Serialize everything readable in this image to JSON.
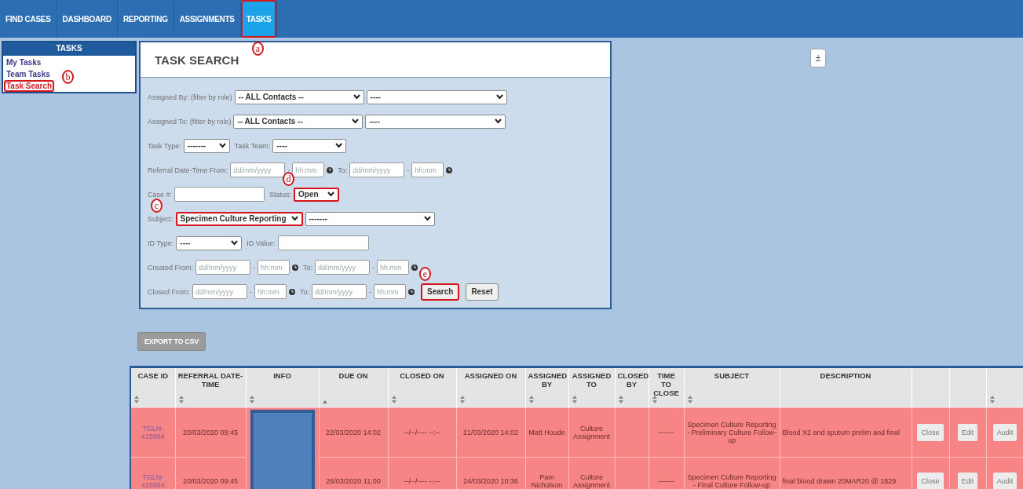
{
  "nav": {
    "tabs": [
      {
        "label": "FIND CASES",
        "selected": false,
        "highlighted": false
      },
      {
        "label": "DASHBOARD",
        "selected": false,
        "highlighted": false
      },
      {
        "label": "REPORTING",
        "selected": false,
        "highlighted": false
      },
      {
        "label": "ASSIGNMENTS",
        "selected": false,
        "highlighted": false
      },
      {
        "label": "TASKS",
        "selected": true,
        "highlighted": true
      }
    ]
  },
  "sidebar": {
    "title": "TASKS",
    "items": [
      {
        "label": "My Tasks",
        "selected": false,
        "highlighted": false
      },
      {
        "label": "Team Tasks",
        "selected": false,
        "highlighted": false
      },
      {
        "label": "Task Search",
        "selected": true,
        "highlighted": true
      }
    ]
  },
  "task_search": {
    "title": "TASK SEARCH",
    "lines": [
      {
        "items": [
          {
            "kind": "label",
            "text": "Assigned By: (filter by role)"
          },
          {
            "kind": "select",
            "value": "-- ALL Contacts --",
            "highlighted": false
          },
          {
            "kind": "select",
            "value": "----",
            "highlighted": false
          }
        ]
      },
      {
        "items": [
          {
            "kind": "label",
            "text": "Assigned To: (filter by role)"
          },
          {
            "kind": "select",
            "value": "-- ALL Contacts --",
            "highlighted": false
          },
          {
            "kind": "select",
            "value": "----",
            "highlighted": false
          }
        ]
      },
      {
        "items": [
          {
            "kind": "label",
            "text": "Task Type:"
          },
          {
            "kind": "select",
            "value": "-------",
            "highlighted": false
          },
          {
            "kind": "label",
            "text": "Task Team:"
          },
          {
            "kind": "select",
            "value": "----",
            "highlighted": false
          }
        ]
      },
      {
        "items": [
          {
            "kind": "label",
            "text": "Referral Date-Time From:"
          },
          {
            "kind": "date",
            "placeholder": "dd/mm/yyyy"
          },
          {
            "kind": "dash",
            "text": "-"
          },
          {
            "kind": "time",
            "placeholder": "hh:mm"
          },
          {
            "kind": "clock"
          },
          {
            "kind": "label",
            "text": "To:"
          },
          {
            "kind": "date",
            "placeholder": "dd/mm/yyyy"
          },
          {
            "kind": "dash",
            "text": "-"
          },
          {
            "kind": "time",
            "placeholder": "hh:mm"
          },
          {
            "kind": "clock"
          }
        ]
      },
      {
        "items": [
          {
            "kind": "label",
            "text": "Case #:"
          },
          {
            "kind": "input"
          },
          {
            "kind": "label",
            "text": "Status:"
          },
          {
            "kind": "select",
            "value": "Open",
            "highlighted": true
          }
        ]
      },
      {
        "items": [
          {
            "kind": "label",
            "text": "Subject:"
          },
          {
            "kind": "select",
            "value": "Specimen Culture Reporting",
            "highlighted": true
          },
          {
            "kind": "select",
            "value": "-------",
            "highlighted": false
          }
        ]
      },
      {
        "items": [
          {
            "kind": "label",
            "text": "ID Type:"
          },
          {
            "kind": "select",
            "value": "----",
            "highlighted": false
          },
          {
            "kind": "label",
            "text": "ID Value:"
          },
          {
            "kind": "input"
          }
        ]
      },
      {
        "items": [
          {
            "kind": "label",
            "text": "Created From:"
          },
          {
            "kind": "date",
            "placeholder": "dd/mm/yyyy"
          },
          {
            "kind": "dash",
            "text": "-"
          },
          {
            "kind": "time",
            "placeholder": "hh:mm"
          },
          {
            "kind": "clock"
          },
          {
            "kind": "label",
            "text": "To:"
          },
          {
            "kind": "date",
            "placeholder": "dd/mm/yyyy"
          },
          {
            "kind": "dash",
            "text": "-"
          },
          {
            "kind": "time",
            "placeholder": "hh:mm"
          },
          {
            "kind": "clock"
          }
        ]
      },
      {
        "items": [
          {
            "kind": "label",
            "text": "Closed From:"
          },
          {
            "kind": "date",
            "placeholder": "dd/mm/yyyy"
          },
          {
            "kind": "dash",
            "text": "-"
          },
          {
            "kind": "time",
            "placeholder": "hh:mm"
          },
          {
            "kind": "clock"
          },
          {
            "kind": "label",
            "text": "To:"
          },
          {
            "kind": "date",
            "placeholder": "dd/mm/yyyy"
          },
          {
            "kind": "dash",
            "text": "-"
          },
          {
            "kind": "time",
            "placeholder": "hh:mm"
          },
          {
            "kind": "clock"
          },
          {
            "kind": "button",
            "text": "Search",
            "highlighted": true
          },
          {
            "kind": "button",
            "text": "Reset",
            "highlighted": false
          }
        ]
      }
    ]
  },
  "toggle_button": {
    "label": "±"
  },
  "export_button": {
    "label": "EXPORT TO CSV"
  },
  "table": {
    "columns": [
      {
        "label": "CASE ID",
        "sortable": true,
        "sorted_ascending": false
      },
      {
        "label": "REFERRAL DATE-TIME",
        "sortable": true,
        "sorted_ascending": false
      },
      {
        "label": "INFO",
        "sortable": true,
        "sorted_ascending": false
      },
      {
        "label": "DUE ON",
        "sortable": true,
        "sorted_ascending": true
      },
      {
        "label": "CLOSED ON",
        "sortable": true,
        "sorted_ascending": false
      },
      {
        "label": "ASSIGNED ON",
        "sortable": true,
        "sorted_ascending": false
      },
      {
        "label": "ASSIGNED BY",
        "sortable": true,
        "sorted_ascending": false
      },
      {
        "label": "ASSIGNED TO",
        "sortable": true,
        "sorted_ascending": false
      },
      {
        "label": "CLOSED BY",
        "sortable": true,
        "sorted_ascending": false
      },
      {
        "label": "TIME TO CLOSE",
        "sortable": true,
        "sorted_ascending": false
      },
      {
        "label": "SUBJECT",
        "sortable": true,
        "sorted_ascending": false
      },
      {
        "label": "DESCRIPTION",
        "sortable": false
      },
      {
        "sortable": false
      },
      {
        "sortable": false
      },
      {
        "sortable": true,
        "sorted_ascending": false
      }
    ],
    "info": {
      "kind": "redacted"
    },
    "rows": [
      {
        "case_id": "TGLN-415964",
        "referral": "20/03/2020 09:45",
        "due_on": "22/03/2020 14:02",
        "closed_on": "--/--/---- --:--",
        "assigned_on": "21/03/2020 14:02",
        "assigned_by": "Matt Houde",
        "assigned_to": "Culture Assignment",
        "time_to_close": "-------",
        "subject": "Specimen Culture Reporting - Preliminary Culture Follow-up",
        "description": "Blood X2 and sputum prelim and final",
        "actions": [
          "Close",
          "Edit",
          "Audit"
        ]
      },
      {
        "case_id": "TGLN-415964",
        "referral": "20/03/2020 09:45",
        "due_on": "26/03/2020 11:00",
        "closed_on": "--/--/---- --:--",
        "assigned_on": "24/03/2020 10:36",
        "assigned_by": "Pam Nicholson",
        "assigned_to": "Culture Assignment",
        "time_to_close": "-------",
        "subject": "Specimen Culture Reporting - Final Culture Follow-up",
        "description": "final blood drawn 20MAR20 @ 1829",
        "actions": [
          "Close",
          "Edit",
          "Audit"
        ]
      }
    ]
  },
  "callouts": [
    {
      "label": "a"
    },
    {
      "label": "b"
    },
    {
      "label": "c"
    },
    {
      "label": "d"
    },
    {
      "label": "e"
    }
  ]
}
